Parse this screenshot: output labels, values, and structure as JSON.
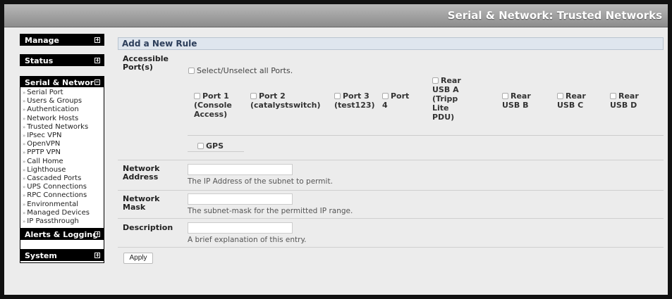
{
  "header": {
    "title": "Serial & Network: Trusted Networks"
  },
  "sidebar": {
    "manage": "Manage",
    "status": "Status",
    "serial_network": "Serial & Network",
    "items": [
      "Serial Port",
      "Users & Groups",
      "Authentication",
      "Network Hosts",
      "Trusted Networks",
      "IPsec VPN",
      "OpenVPN",
      "PPTP VPN",
      "Call Home",
      "Lighthouse",
      "Cascaded Ports",
      "UPS Connections",
      "RPC Connections",
      "Environmental",
      "Managed Devices",
      "IP Passthrough"
    ],
    "alerts_logging": "Alerts & Logging",
    "system": "System"
  },
  "form": {
    "heading": "Add a New Rule",
    "accessible_ports_label": "Accessible\nPort(s)",
    "select_all": "Select/Unselect all Ports.",
    "ports": [
      "Port 1\n(Console\nAccess)",
      "Port 2\n(catalystswitch)",
      "Port 3\n(test123)",
      "Port\n4",
      "Rear\nUSB A\n(Tripp\nLite\nPDU)",
      "Rear\nUSB B",
      "Rear\nUSB C",
      "Rear\nUSB D"
    ],
    "gps": "GPS",
    "network_address_label": "Network\nAddress",
    "network_address_value": "",
    "network_address_help": "The IP Address of the subnet to permit.",
    "network_mask_label": "Network\nMask",
    "network_mask_value": "",
    "network_mask_help": "The subnet-mask for the permitted IP range.",
    "description_label": "Description",
    "description_value": "",
    "description_help": "A brief explanation of this entry.",
    "apply": "Apply"
  }
}
